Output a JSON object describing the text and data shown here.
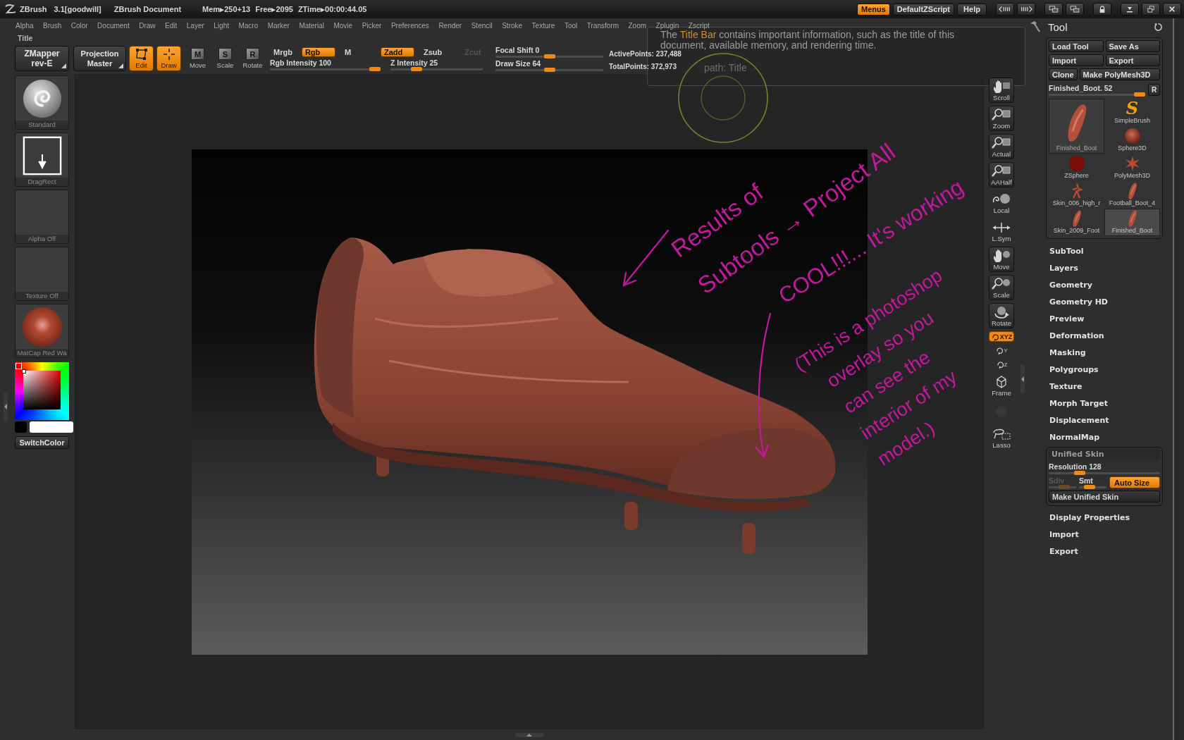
{
  "title_bar": {
    "app": "ZBrush",
    "version": "3.1[goodwill]",
    "document": "ZBrush Document",
    "stats": [
      "Mem▸250+13",
      "Free▸2095",
      "ZTime▸00:00:44.05"
    ],
    "buttons": [
      {
        "label": "Menus",
        "on": true
      },
      {
        "label": "DefaultZScript",
        "on": false
      },
      {
        "label": "Help",
        "on": false
      }
    ]
  },
  "menu_bar": [
    "Alpha",
    "Brush",
    "Color",
    "Document",
    "Draw",
    "Edit",
    "Layer",
    "Light",
    "Macro",
    "Marker",
    "Material",
    "Movie",
    "Picker",
    "Preferences",
    "Render",
    "Stencil",
    "Stroke",
    "Texture",
    "Tool",
    "Transform",
    "Zoom",
    "Zplugin",
    "Zscript"
  ],
  "tooltip": {
    "text": "The **Title Bar** contains important information, such as the title of this document, available memory, and rendering time.",
    "path": "path: Title"
  },
  "shelf": {
    "section_label": "Title",
    "plugin_buttons": [
      {
        "lines": [
          "ZMapper",
          "rev-E"
        ]
      },
      {
        "lines": [
          "Projection",
          "Master"
        ]
      }
    ],
    "modes": [
      {
        "label": "Edit",
        "on": true
      },
      {
        "label": "Draw",
        "on": true
      },
      {
        "label": "Move",
        "glyph": "M",
        "on": false
      },
      {
        "label": "Scale",
        "glyph": "S",
        "on": false
      },
      {
        "label": "Rotate",
        "glyph": "R",
        "on": false
      }
    ],
    "color_modes": [
      {
        "label": "Mrgb",
        "on": false
      },
      {
        "label": "Rgb",
        "on": true
      },
      {
        "label": "M",
        "on": false
      }
    ],
    "rgb_intensity": {
      "label": "Rgb Intensity 100",
      "level": 1
    },
    "z_modes": [
      {
        "label": "Zadd",
        "on": true,
        "disabled": false
      },
      {
        "label": "Zsub",
        "on": false,
        "disabled": false
      },
      {
        "label": "Zcut",
        "on": false,
        "disabled": true
      }
    ],
    "z_intensity": {
      "label": "Z Intensity 25",
      "level": 0.25
    },
    "focal_shift": {
      "label": "Focal Shift 0",
      "level": 0.5
    },
    "draw_size": {
      "label": "Draw Size 64",
      "level": 0.5
    },
    "active_points": "ActivePoints: 237,488",
    "total_points": "TotalPoints: 372,973"
  },
  "left_panel": {
    "tiles": [
      {
        "label": "Standard"
      },
      {
        "label": "DragRect"
      },
      {
        "label": "Alpha Off"
      },
      {
        "label": "Texture Off"
      },
      {
        "label": "MatCap Red Wa"
      }
    ],
    "swatches": [
      {
        "color": "#000000"
      },
      {
        "color": "#ffffff"
      }
    ],
    "switch_color": "SwitchColor"
  },
  "viewport_tools": [
    {
      "label": "Scroll",
      "kind": "tile"
    },
    {
      "label": "Zoom",
      "kind": "tile"
    },
    {
      "label": "Actual",
      "kind": "tile"
    },
    {
      "label": "AAHalf",
      "kind": "tile"
    },
    {
      "label": "Local",
      "kind": "bare"
    },
    {
      "label": "L.Sym",
      "kind": "bare"
    },
    {
      "label": "Move",
      "kind": "tile"
    },
    {
      "label": "Scale",
      "kind": "tile"
    },
    {
      "label": "Rotate",
      "kind": "tile"
    },
    {
      "label": "XYZ",
      "kind": "toggle",
      "on": true
    },
    {
      "label": "Y",
      "kind": "axis",
      "on": false
    },
    {
      "label": "Z",
      "kind": "axis",
      "on": false
    },
    {
      "label": "Frame",
      "kind": "bare"
    },
    {
      "kind": "faded"
    },
    {
      "label": "Lasso",
      "kind": "bare"
    }
  ],
  "annotations": [
    {
      "lines": [
        "Results of",
        "Subtools → Project All"
      ]
    },
    {
      "lines": [
        "COOL!!!... It's working"
      ]
    },
    {
      "lines": [
        "(This is a photoshop",
        "overlay so you",
        "can see the",
        "interior of my",
        "model.)"
      ]
    }
  ],
  "tray": {
    "title": "Tool",
    "button_rows": [
      [
        "Load Tool",
        "Save As"
      ],
      [
        "Import",
        "Export"
      ],
      [
        "Clone",
        "Make PolyMesh3D"
      ]
    ],
    "slider": {
      "label": "Finished_Boot. 52",
      "level": 1,
      "button": "R"
    },
    "current_tool": {
      "label": "Finished_Boot"
    },
    "tools": [
      {
        "label": "SimpleBrush",
        "glyph": "S",
        "selected": false
      },
      {
        "label": "Sphere3D",
        "selected": false
      },
      {
        "label": "ZSphere",
        "selected": false
      },
      {
        "label": "PolyMesh3D",
        "selected": false
      },
      {
        "label": "Skin_006_high_r",
        "selected": false
      },
      {
        "label": "Football_Boot_4",
        "selected": false
      },
      {
        "label": "Skin_2009_Foot",
        "selected": false
      },
      {
        "label": "Finished_Boot",
        "selected": true
      }
    ],
    "palettes": [
      {
        "label": "SubTool",
        "expanded": false
      },
      {
        "label": "Layers",
        "expanded": false
      },
      {
        "label": "Geometry",
        "expanded": false
      },
      {
        "label": "Geometry HD",
        "expanded": false
      },
      {
        "label": "Preview",
        "expanded": false
      },
      {
        "label": "Deformation",
        "expanded": false
      },
      {
        "label": "Masking",
        "expanded": false
      },
      {
        "label": "Polygroups",
        "expanded": false
      },
      {
        "label": "Texture",
        "expanded": false
      },
      {
        "label": "Morph Target",
        "expanded": false
      },
      {
        "label": "Displacement",
        "expanded": false
      },
      {
        "label": "NormalMap",
        "expanded": false
      },
      {
        "label": "Unified Skin",
        "expanded": true,
        "rows": [
          [
            {
              "kind": "slider",
              "label": "Resolution 128",
              "level": 0.25,
              "disabled": false
            }
          ],
          [
            {
              "kind": "slider",
              "label": "Sdiv",
              "level": 0.6,
              "disabled": true
            },
            {
              "kind": "slider",
              "label": "Smt",
              "level": 0.3,
              "disabled": false
            },
            {
              "kind": "toggle",
              "label": "Auto Size",
              "on": true
            }
          ],
          [
            {
              "kind": "button",
              "label": "Make Unified Skin"
            }
          ]
        ]
      },
      {
        "label": "Display Properties",
        "expanded": false
      },
      {
        "label": "Import",
        "expanded": false
      },
      {
        "label": "Export",
        "expanded": false
      }
    ]
  }
}
